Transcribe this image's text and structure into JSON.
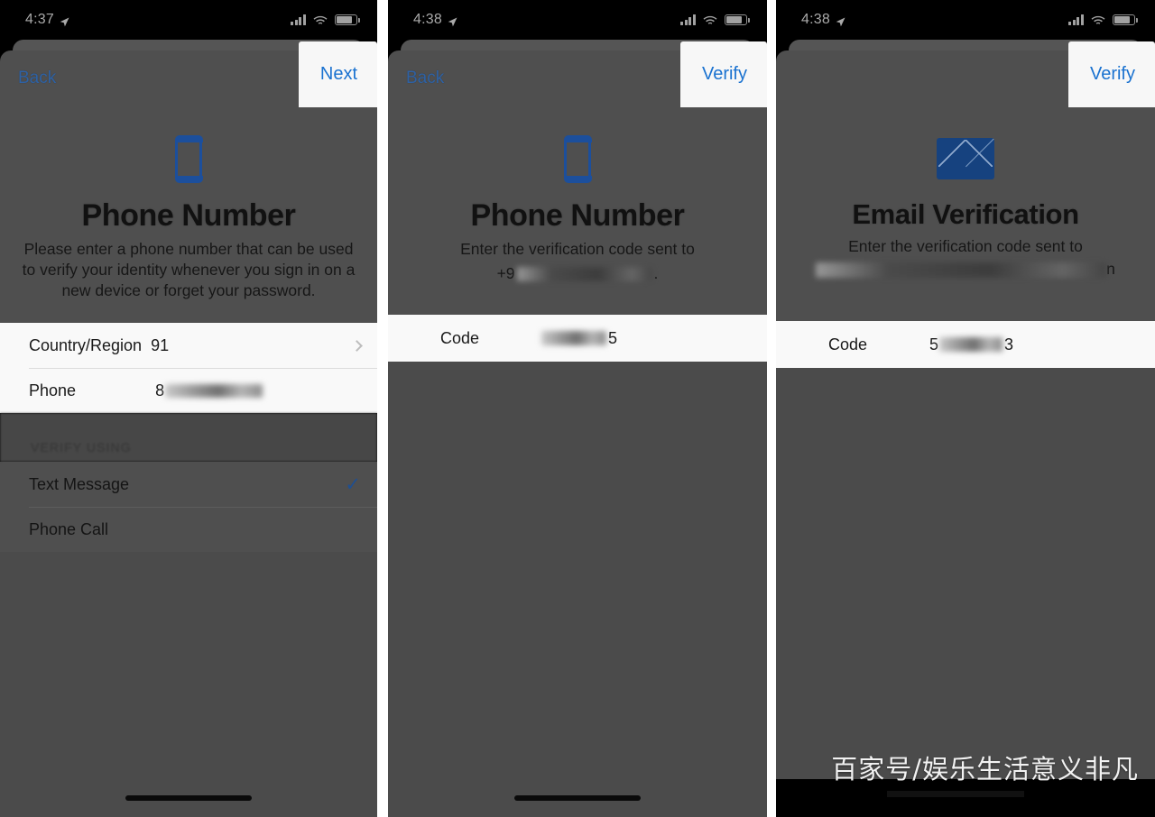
{
  "meta": {
    "device": "iPhone",
    "accent_blue": "#1a72d0",
    "dim_overlay": "#4f4f4f",
    "list_background": "#f9f9f9"
  },
  "watermark": {
    "text": "百家号/娱乐生活意义非凡"
  },
  "panels": [
    {
      "id": "phone-number-entry",
      "status_bar": {
        "time": "4:37",
        "location_icon": "location-arrow-icon",
        "signal_icon": "cellular-signal-icon",
        "wifi_icon": "wifi-icon",
        "battery_icon": "battery-icon"
      },
      "navbar": {
        "back_label": "Back",
        "action_label": "Next"
      },
      "hero": {
        "icon": "phone-icon",
        "title": "Phone Number",
        "subtitle": "Please enter a phone number that can be used to verify your identity whenever you sign in on a new device or forget your password."
      },
      "form": {
        "rows": [
          {
            "label": "Country/Region",
            "value": "91",
            "accessory": "chevron-right-icon",
            "masked": false
          },
          {
            "label": "Phone",
            "value": "8",
            "masked": true,
            "mask_width": 108
          }
        ]
      },
      "section": {
        "header": "VERIFY USING",
        "options": [
          {
            "label": "Text Message",
            "selected": true,
            "check_icon": "checkmark-icon"
          },
          {
            "label": "Phone Call",
            "selected": false
          }
        ]
      },
      "home_indicator": true
    },
    {
      "id": "phone-code-verification",
      "status_bar": {
        "time": "4:38",
        "location_icon": "location-arrow-icon",
        "signal_icon": "cellular-signal-icon",
        "wifi_icon": "wifi-icon",
        "battery_icon": "battery-icon"
      },
      "navbar": {
        "back_label": "Back",
        "action_label": "Verify"
      },
      "hero": {
        "icon": "phone-icon",
        "title": "Phone Number",
        "subtitle": "Enter the verification code sent to",
        "target_prefix": "+9",
        "target_masked": true,
        "target_suffix": "."
      },
      "form": {
        "rows": [
          {
            "label": "Code",
            "value": "",
            "masked": true,
            "mask_width": 72,
            "value_suffix": "5"
          }
        ]
      },
      "home_indicator": true
    },
    {
      "id": "email-code-verification",
      "status_bar": {
        "time": "4:38",
        "location_icon": "location-arrow-icon",
        "signal_icon": "cellular-signal-icon",
        "wifi_icon": "wifi-icon",
        "battery_icon": "battery-icon"
      },
      "navbar": {
        "back_label": "",
        "action_label": "Verify"
      },
      "hero": {
        "icon": "envelope-icon",
        "title": "Email Verification",
        "subtitle": "Enter the verification code sent to",
        "target_prefix": "",
        "target_masked": true,
        "target_suffix": "n"
      },
      "form": {
        "rows": [
          {
            "label": "Code",
            "value": "5",
            "masked": true,
            "mask_width": 72,
            "value_suffix": "3"
          }
        ]
      },
      "home_indicator": false
    }
  ]
}
